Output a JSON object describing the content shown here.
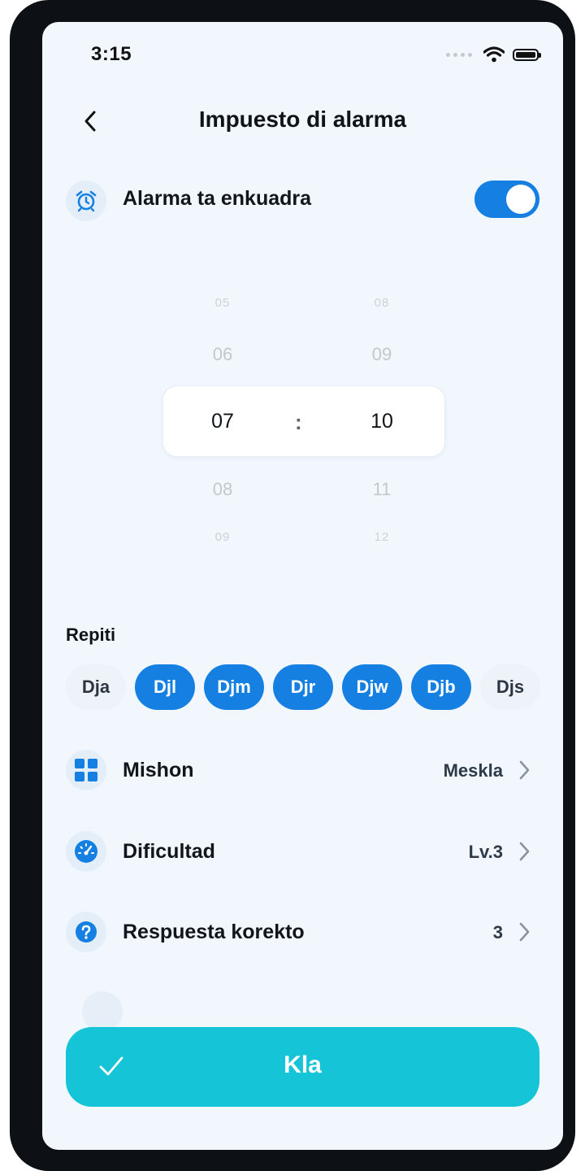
{
  "status_bar": {
    "time": "3:15"
  },
  "header": {
    "title": "Impuesto di alarma"
  },
  "alarm_toggle": {
    "label": "Alarma ta enkuadra",
    "enabled": true,
    "accent_color": "#1580e2"
  },
  "time_picker": {
    "hours": {
      "far_above": "05",
      "above": "06",
      "selected": "07",
      "below": "08",
      "far_below": "09"
    },
    "minutes": {
      "far_above": "08",
      "above": "09",
      "selected": "10",
      "below": "11",
      "far_below": "12"
    },
    "separator": ":"
  },
  "repeat": {
    "title": "Repiti",
    "days": [
      {
        "label": "Dja",
        "selected": false
      },
      {
        "label": "Djl",
        "selected": true
      },
      {
        "label": "Djm",
        "selected": true
      },
      {
        "label": "Djr",
        "selected": true
      },
      {
        "label": "Djw",
        "selected": true
      },
      {
        "label": "Djb",
        "selected": true
      },
      {
        "label": "Djs",
        "selected": false
      }
    ]
  },
  "settings": {
    "mission": {
      "label": "Mishon",
      "value": "Meskla",
      "icon": "grid-icon"
    },
    "difficulty": {
      "label": "Dificultad",
      "value": "Lv.3",
      "icon": "gauge-icon"
    },
    "correct_answers": {
      "label": "Respuesta korekto",
      "value": "3",
      "icon": "question-icon"
    }
  },
  "save_button": {
    "label": "Kla",
    "color": "#15c4d6"
  }
}
